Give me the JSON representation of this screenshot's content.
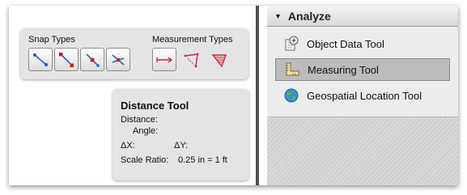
{
  "snap_panel": {
    "label": "Snap Types",
    "buttons": [
      {
        "icon": "snap-to-endpoint-icon"
      },
      {
        "icon": "snap-to-endpoint-square-icon"
      },
      {
        "icon": "snap-to-midpoint-icon"
      },
      {
        "icon": "snap-to-intersection-icon"
      }
    ]
  },
  "measurement_panel": {
    "label": "Measurement Types",
    "buttons": [
      {
        "icon": "distance-measure-icon"
      },
      {
        "icon": "perimeter-measure-icon"
      },
      {
        "icon": "area-measure-icon"
      }
    ]
  },
  "distance_tool": {
    "title": "Distance Tool",
    "distance_label": "Distance:",
    "angle_label": "Angle:",
    "dx_label": "ΔX:",
    "dy_label": "ΔY:",
    "scale_label": "Scale Ratio:",
    "scale_value": "0.25 in = 1 ft"
  },
  "sidebar": {
    "header": "Analyze",
    "items": [
      {
        "label": "Object Data Tool",
        "icon": "object-data-icon",
        "selected": false
      },
      {
        "label": "Measuring Tool",
        "icon": "ruler-icon",
        "selected": true
      },
      {
        "label": "Geospatial Location Tool",
        "icon": "globe-icon",
        "selected": false
      }
    ]
  },
  "colors": {
    "measure_accent": "#c8283c",
    "snap_line": "#2c64b4",
    "snap_point": "#c81e1e",
    "selected_row": "#bcbcbc"
  }
}
